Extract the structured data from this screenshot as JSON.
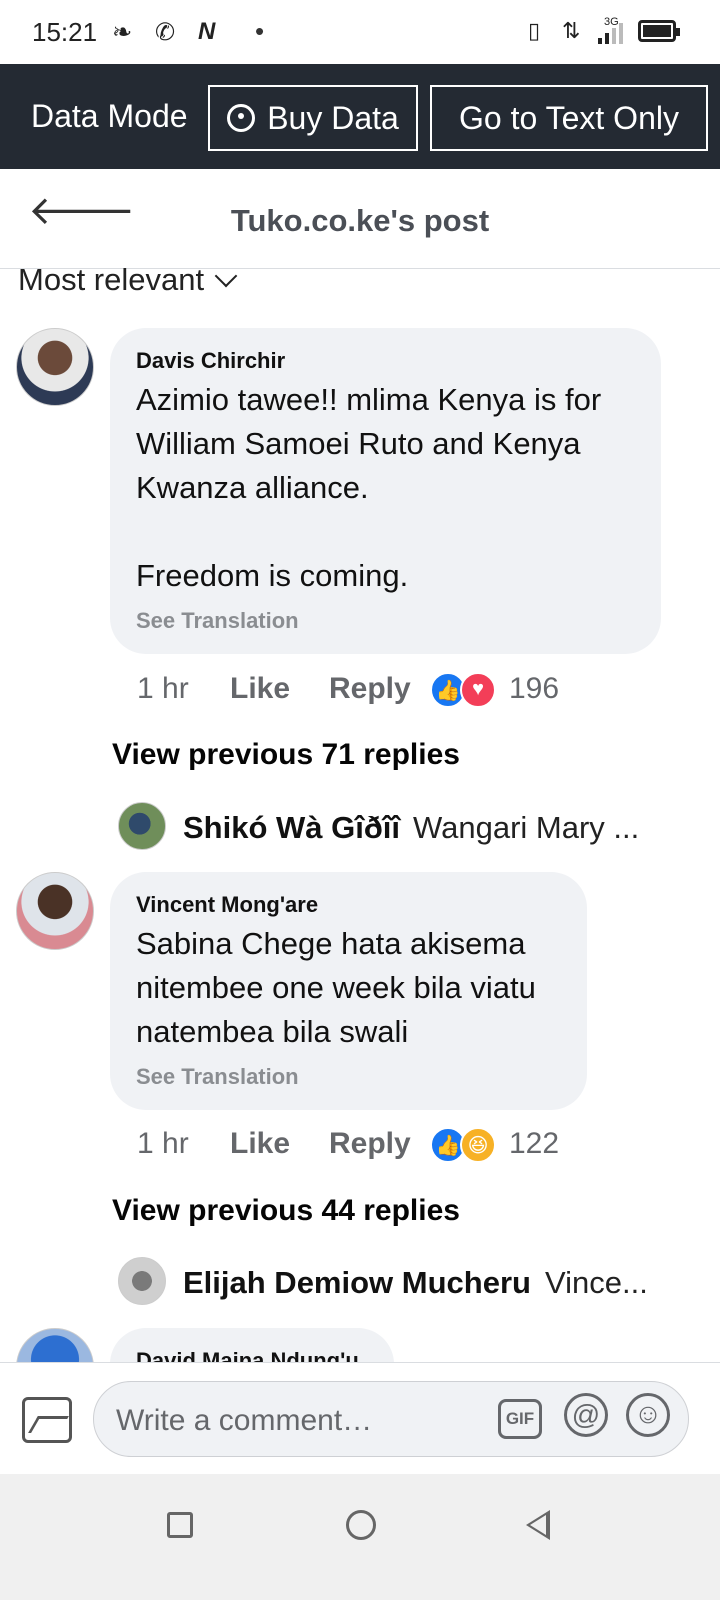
{
  "status_bar": {
    "time": "15:21",
    "network": "3G"
  },
  "data_bar": {
    "mode_label": "Data Mode",
    "buy_label": "Buy Data",
    "text_only_label": "Go to Text Only"
  },
  "header": {
    "title": "Tuko.co.ke's post"
  },
  "sort": {
    "label": "Most relevant"
  },
  "comments": [
    {
      "author": "Davis Chirchir",
      "text": "Azimio tawee!! mlima Kenya is for William Samoei Ruto and Kenya Kwanza alliance.\n\nFreedom is coming.",
      "translate": "See Translation",
      "time": "1 hr",
      "like": "Like",
      "reply": "Reply",
      "reactions": [
        "like",
        "love"
      ],
      "reaction_count": "196",
      "view_previous": "View previous 71 replies",
      "latest_reply": {
        "author": "Shikó Wà Gîðîî",
        "text": "Wangari Mary ..."
      }
    },
    {
      "author": "Vincent Mong'are",
      "text": "Sabina Chege hata akisema nitembee one week bila viatu natembea bila swali",
      "translate": "See Translation",
      "time": "1 hr",
      "like": "Like",
      "reply": "Reply",
      "reactions": [
        "like",
        "haha"
      ],
      "reaction_count": "122",
      "view_previous": "View previous 44 replies",
      "latest_reply": {
        "author": "Elijah Demiow Mucheru",
        "text": "Vince..."
      }
    },
    {
      "author": "David Maina Ndung'u"
    }
  ],
  "composer": {
    "placeholder": "Write a comment…",
    "gif_label": "GIF",
    "at_label": "@"
  },
  "colors": {
    "data_bar_bg": "#242a33",
    "bubble_bg": "#f0f2f5",
    "like_blue": "#1877f2",
    "love_red": "#f33e58"
  }
}
